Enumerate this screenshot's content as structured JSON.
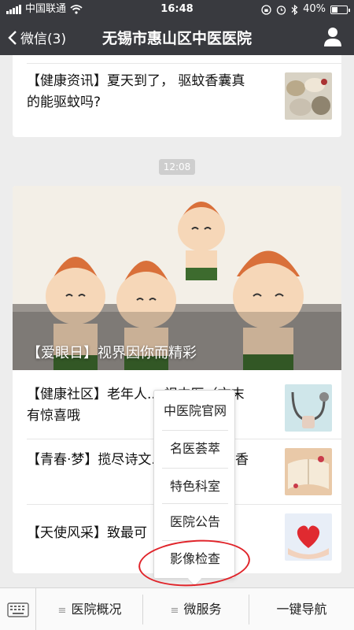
{
  "status_bar": {
    "carrier": "中国联通",
    "time": "16:48",
    "battery": "40%",
    "battery_level": 0.4
  },
  "nav": {
    "back_label": "微信(3)",
    "title": "无锡市惠山区中医医院"
  },
  "articles_top": [
    {
      "title": "【健康资讯】夏天到了， 驱蚊香囊真的能驱蚊吗?"
    }
  ],
  "timestamp": "12:08",
  "cover": {
    "title": "【爱眼日】视界因你而精彩"
  },
  "articles": [
    {
      "title": "【健康社区】老年人... 视中医（文末有惊喜哦"
    },
    {
      "title": "【青春·梦】揽尽诗文... 的青春尽书香"
    },
    {
      "title": "【天使风采】致最可"
    }
  ],
  "popup_menu": {
    "items": [
      "中医院官网",
      "名医荟萃",
      "特色科室",
      "医院公告",
      "影像检查"
    ]
  },
  "bottom_menu": {
    "items": [
      "医院概况",
      "微服务",
      "一键导航"
    ]
  },
  "colors": {
    "nav_bg": "#393a3f",
    "page_bg": "#ededed",
    "annotation": "#e0242a"
  }
}
